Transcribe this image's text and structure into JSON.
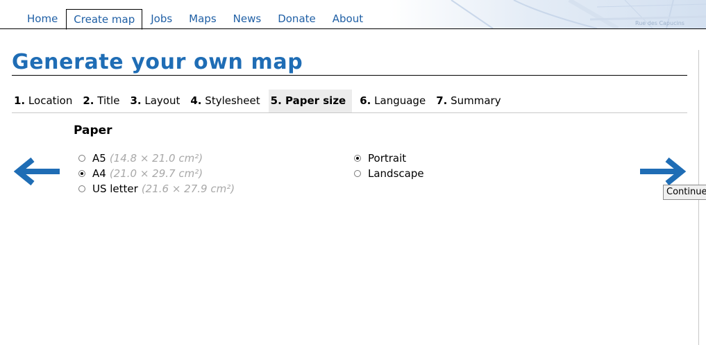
{
  "nav": {
    "tabs": [
      {
        "label": "Home"
      },
      {
        "label": "Create map"
      },
      {
        "label": "Jobs"
      },
      {
        "label": "Maps"
      },
      {
        "label": "News"
      },
      {
        "label": "Donate"
      },
      {
        "label": "About"
      }
    ],
    "active": "Create map",
    "background_map_text": [
      "Rue des Capucins"
    ]
  },
  "page_title": "Generate your own map",
  "steps": [
    {
      "num": "1.",
      "label": "Location"
    },
    {
      "num": "2.",
      "label": "Title"
    },
    {
      "num": "3.",
      "label": "Layout"
    },
    {
      "num": "4.",
      "label": "Stylesheet"
    },
    {
      "num": "5.",
      "label": "Paper size"
    },
    {
      "num": "6.",
      "label": "Language"
    },
    {
      "num": "7.",
      "label": "Summary"
    }
  ],
  "active_step": "Paper size",
  "paper": {
    "heading": "Paper",
    "sizes": [
      {
        "label": "A5",
        "dims": "(14.8 × 21.0 cm²)",
        "checked": false
      },
      {
        "label": "A4",
        "dims": "(21.0 × 29.7 cm²)",
        "checked": true
      },
      {
        "label": "US letter",
        "dims": "(21.6 × 27.9 cm²)",
        "checked": false
      }
    ],
    "orientations": [
      {
        "label": "Portrait",
        "checked": true
      },
      {
        "label": "Landscape",
        "checked": false
      }
    ]
  },
  "navigation": {
    "back_icon": "arrow-left-icon",
    "next_icon": "arrow-right-icon",
    "tooltip": "Continue"
  },
  "colors": {
    "accent": "#1f6db5",
    "link": "#1f5fa5",
    "active_step_bg": "#ececec"
  }
}
